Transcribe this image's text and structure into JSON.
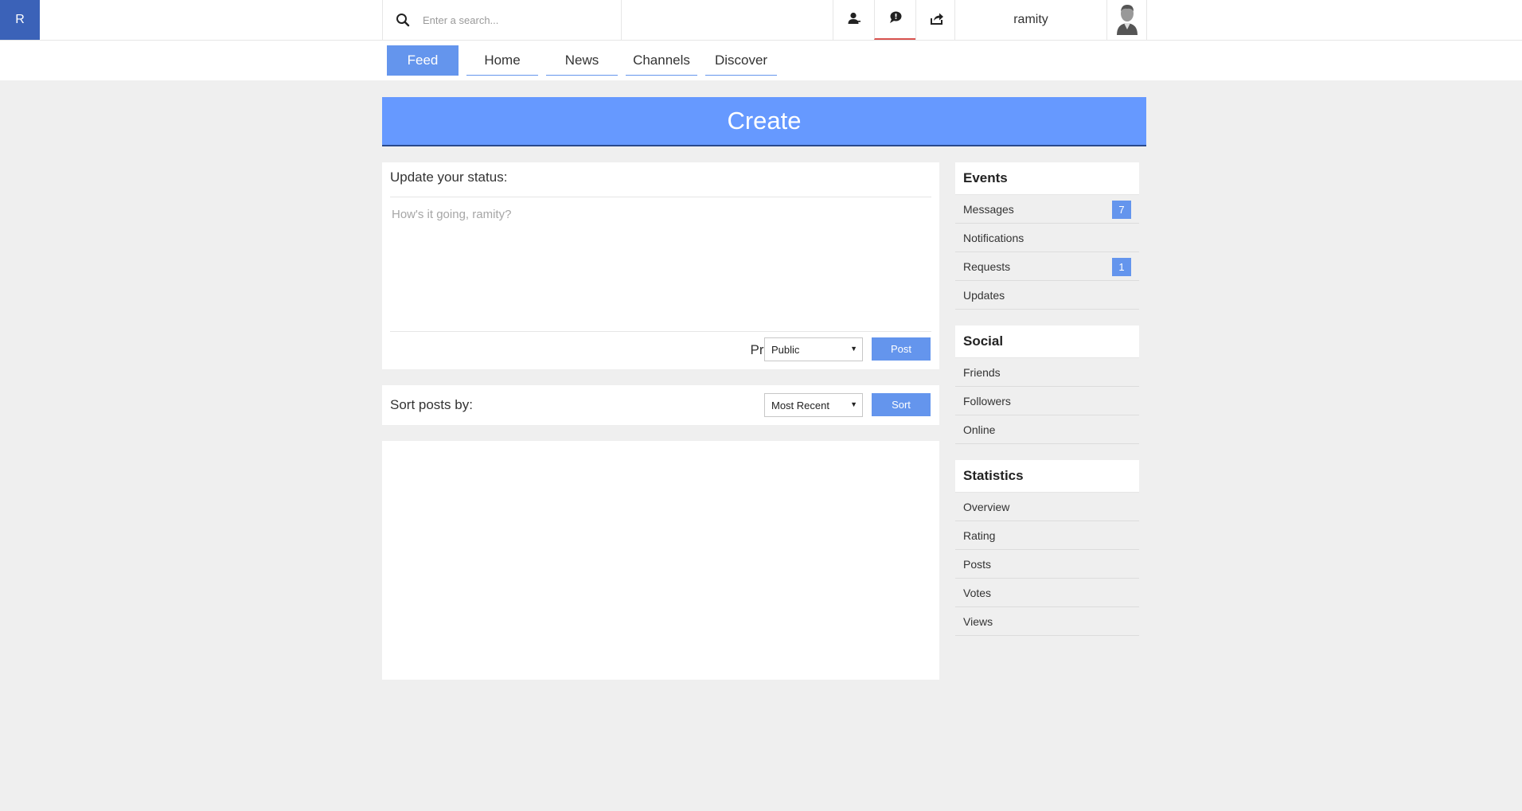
{
  "logo": {
    "letter": "R"
  },
  "search": {
    "placeholder": "Enter a search..."
  },
  "header": {
    "icons": [
      "user-icon",
      "chat-icon",
      "share-icon"
    ],
    "username": "ramity"
  },
  "nav": {
    "tabs": [
      {
        "label": "Feed",
        "active": true
      },
      {
        "label": "Home"
      },
      {
        "label": "News"
      },
      {
        "label": "Channels"
      },
      {
        "label": "Discover"
      }
    ]
  },
  "banner": {
    "title": "Create"
  },
  "status": {
    "title": "Update your status:",
    "placeholder": "How's it going, ramity?",
    "privacy_label": "Privacy:",
    "privacy_value": "Public",
    "post_label": "Post"
  },
  "sort": {
    "label": "Sort posts by:",
    "value": "Most Recent",
    "button_label": "Sort"
  },
  "sidebar": {
    "events": {
      "title": "Events",
      "items": [
        {
          "label": "Messages",
          "badge": "7"
        },
        {
          "label": "Notifications"
        },
        {
          "label": "Requests",
          "badge": "1"
        },
        {
          "label": "Updates"
        }
      ]
    },
    "social": {
      "title": "Social",
      "items": [
        {
          "label": "Friends"
        },
        {
          "label": "Followers"
        },
        {
          "label": "Online"
        }
      ]
    },
    "statistics": {
      "title": "Statistics",
      "items": [
        {
          "label": "Overview"
        },
        {
          "label": "Rating"
        },
        {
          "label": "Posts"
        },
        {
          "label": "Votes"
        },
        {
          "label": "Views"
        }
      ]
    }
  },
  "colors": {
    "accent": "#6495ed",
    "banner": "#6699ff",
    "logo": "#3b62b8",
    "alert": "#d9534f"
  }
}
